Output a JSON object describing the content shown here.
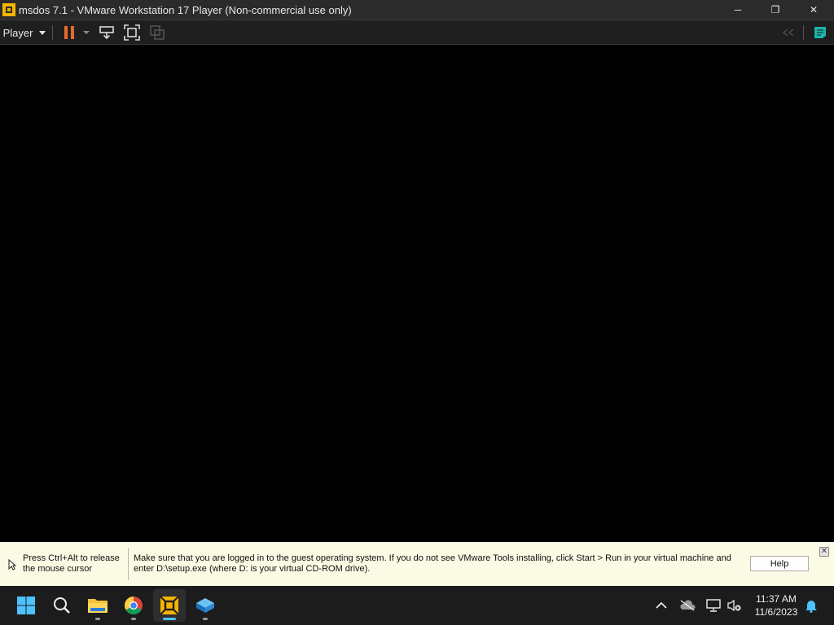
{
  "window": {
    "title": "msdos 7.1 - VMware Workstation 17 Player (Non-commercial use only)",
    "app_icon": "vmware-icon",
    "controls": {
      "minimize": "─",
      "maximize": "❐",
      "close": "✕"
    }
  },
  "toolbar": {
    "player_menu_label": "Player",
    "buttons": [
      {
        "icon": "pause-icon"
      },
      {
        "icon": "dropdown-chevron-icon"
      },
      {
        "icon": "send-ctrl-alt-del-icon"
      },
      {
        "icon": "full-screen-icon"
      },
      {
        "icon": "unity-icon",
        "disabled": true
      },
      {
        "icon": "back-arrows-icon",
        "disabled": true
      },
      {
        "icon": "message-log-icon"
      }
    ]
  },
  "hint_bar": {
    "release_hint": "Press Ctrl+Alt to release the mouse cursor",
    "message": "Make sure that you are logged in to the guest operating system. If you do not see VMware Tools installing, click Start > Run in your virtual machine and enter D:\\setup.exe (where D: is your virtual CD-ROM drive).",
    "help_label": "Help",
    "close_label": "✕"
  },
  "taskbar": {
    "apps": [
      {
        "name": "start-button",
        "icon": "windows-logo-icon"
      },
      {
        "name": "search-button",
        "icon": "search-icon"
      },
      {
        "name": "file-explorer",
        "icon": "folder-icon",
        "running": true
      },
      {
        "name": "chrome",
        "icon": "chrome-icon",
        "running": true
      },
      {
        "name": "vmware-player",
        "icon": "vmware-icon",
        "running": true,
        "active": true
      },
      {
        "name": "virtualbox-like-app",
        "icon": "cube-icon",
        "running": true
      }
    ],
    "tray": [
      "chevron-up-icon",
      "onedrive-offline-icon",
      "network-icon",
      "volume-muted-icon"
    ],
    "time": "11:37 AM",
    "date": "11/6/2023",
    "notification_icon": "bell-icon"
  },
  "colors": {
    "titlebar": "#2b2b2b",
    "toolbar": "#1f1f1f",
    "pause_accent": "#e8692d",
    "hint_background": "#fbfae4",
    "taskbar": "#1c1c1c",
    "active_indicator": "#4cc2ff"
  }
}
